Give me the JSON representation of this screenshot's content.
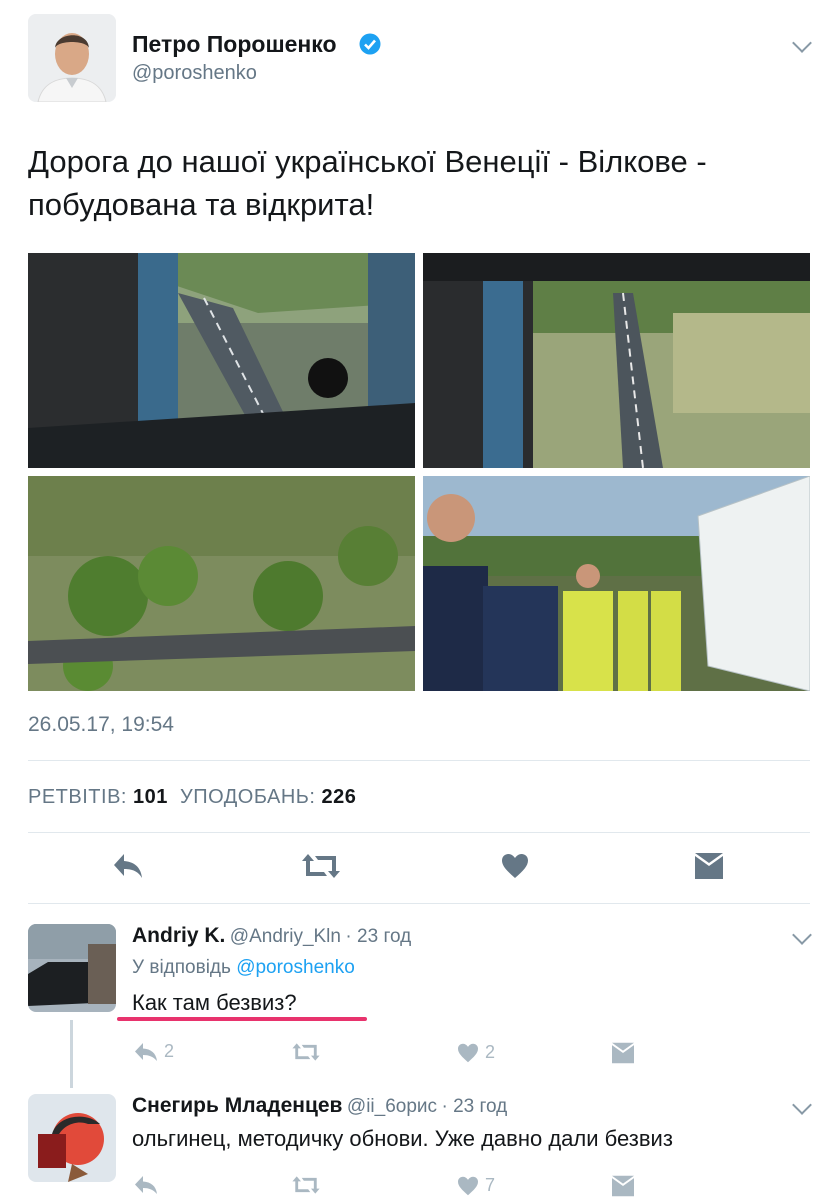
{
  "tweet": {
    "author_name": "Петро Порошенко",
    "author_handle": "@poroshenko",
    "text": "Дорога до нашої української Венеції - Вілкове - побудована та відкрита!",
    "timestamp": "26.05.17, 19:54",
    "retweets_label": "РЕТВІТІВ:",
    "retweets_count": "101",
    "likes_label": "УПОДОБАНЬ:",
    "likes_count": "226"
  },
  "replies": [
    {
      "name": "Andriy K.",
      "handle": "@Andriy_Kln",
      "time": "· 23 год",
      "reply_to_prefix": "У відповідь",
      "reply_to_handle": "@poroshenko",
      "text": "Как там безвиз?",
      "reply_count": "2",
      "like_count": "2"
    },
    {
      "name": "Снегирь Младенцев",
      "handle": "@ii_6орис",
      "time": "· 23 год",
      "text": "ольгинец, методичку обнови. Уже давно дали безвиз",
      "like_count": "7"
    }
  ],
  "colors": {
    "verified": "#1da1f2",
    "link": "#1da1f2",
    "underline": "#e8336d",
    "action": "#657786"
  }
}
